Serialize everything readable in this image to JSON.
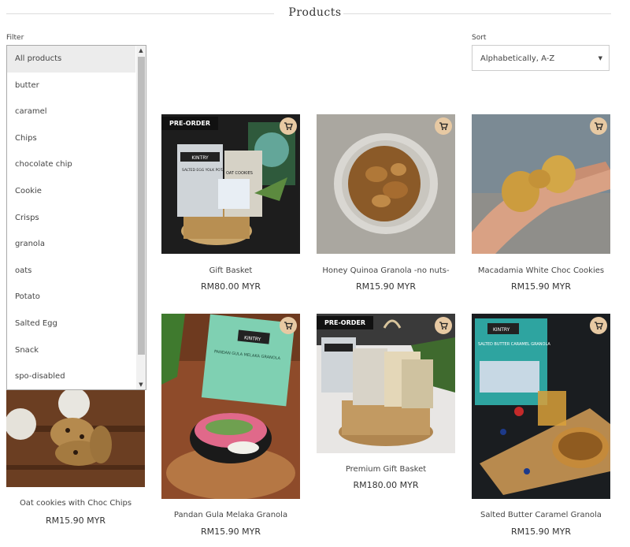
{
  "page": {
    "title": "Products"
  },
  "filter": {
    "label": "Filter",
    "options": [
      "All products",
      "butter",
      "caramel",
      "Chips",
      "chocolate chip",
      "Cookie",
      "Crisps",
      "granola",
      "oats",
      "Potato",
      "Salted Egg",
      "Snack",
      "spo-disabled"
    ]
  },
  "sort": {
    "label": "Sort",
    "value": "Alphabetically, A-Z"
  },
  "products": [
    {
      "name": "Gift Basket",
      "price": "RM80.00 MYR",
      "badge": "PRE-ORDER"
    },
    {
      "name": "Honey Quinoa Granola -no nuts-",
      "price": "RM15.90 MYR"
    },
    {
      "name": "Macadamia White Choc Cookies",
      "price": "RM15.90 MYR"
    },
    {
      "name": "Oat cookies with Choc Chips",
      "price": "RM15.90 MYR"
    },
    {
      "name": "Pandan Gula Melaka Granola",
      "price": "RM15.90 MYR"
    },
    {
      "name": "Premium Gift Basket",
      "price": "RM180.00 MYR",
      "badge": "PRE-ORDER"
    },
    {
      "name": "Salted Butter Caramel Granola",
      "price": "RM15.90 MYR"
    }
  ],
  "image_text": {
    "kintry": "KINTRY",
    "egg_crisps": "SALTED EGG YOLK POTATO CRISPS",
    "oat_cookies": "OAT COOKIES",
    "pandan_pack": "PANDAN GULA MELAKA GRANOLA",
    "caramel_pack": "SALTED BUTTER CARAMEL GRANOLA"
  },
  "colors": {
    "cart_bg": "#e7c9a3",
    "badge_bg": "#111111"
  }
}
